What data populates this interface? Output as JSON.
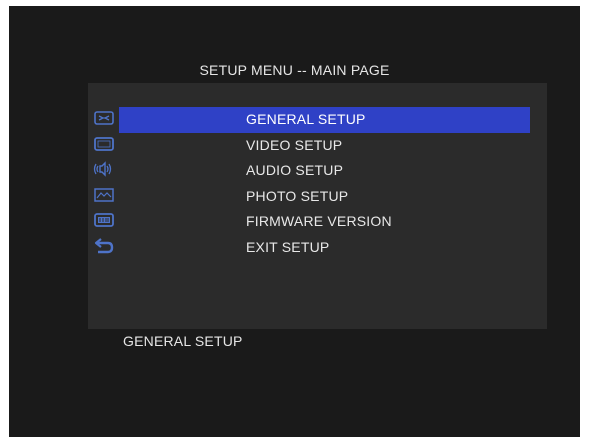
{
  "screen": {
    "title": "SETUP MENU -- MAIN PAGE",
    "status_text": "GENERAL SETUP"
  },
  "menu": {
    "selected_index": 0,
    "items": [
      {
        "label": "GENERAL SETUP",
        "icon": "general-setup-icon"
      },
      {
        "label": "VIDEO SETUP",
        "icon": "video-setup-icon"
      },
      {
        "label": "AUDIO SETUP",
        "icon": "audio-setup-icon"
      },
      {
        "label": "PHOTO SETUP",
        "icon": "photo-setup-icon"
      },
      {
        "label": "FIRMWARE VERSION",
        "icon": "firmware-version-icon"
      },
      {
        "label": "EXIT SETUP",
        "icon": "exit-setup-icon"
      }
    ]
  },
  "colors": {
    "background": "#1a1a1a",
    "panel": "#2b2b2b",
    "highlight": "#2f41c6",
    "icon": "#4e73c8",
    "text": "#e8e8e8"
  }
}
